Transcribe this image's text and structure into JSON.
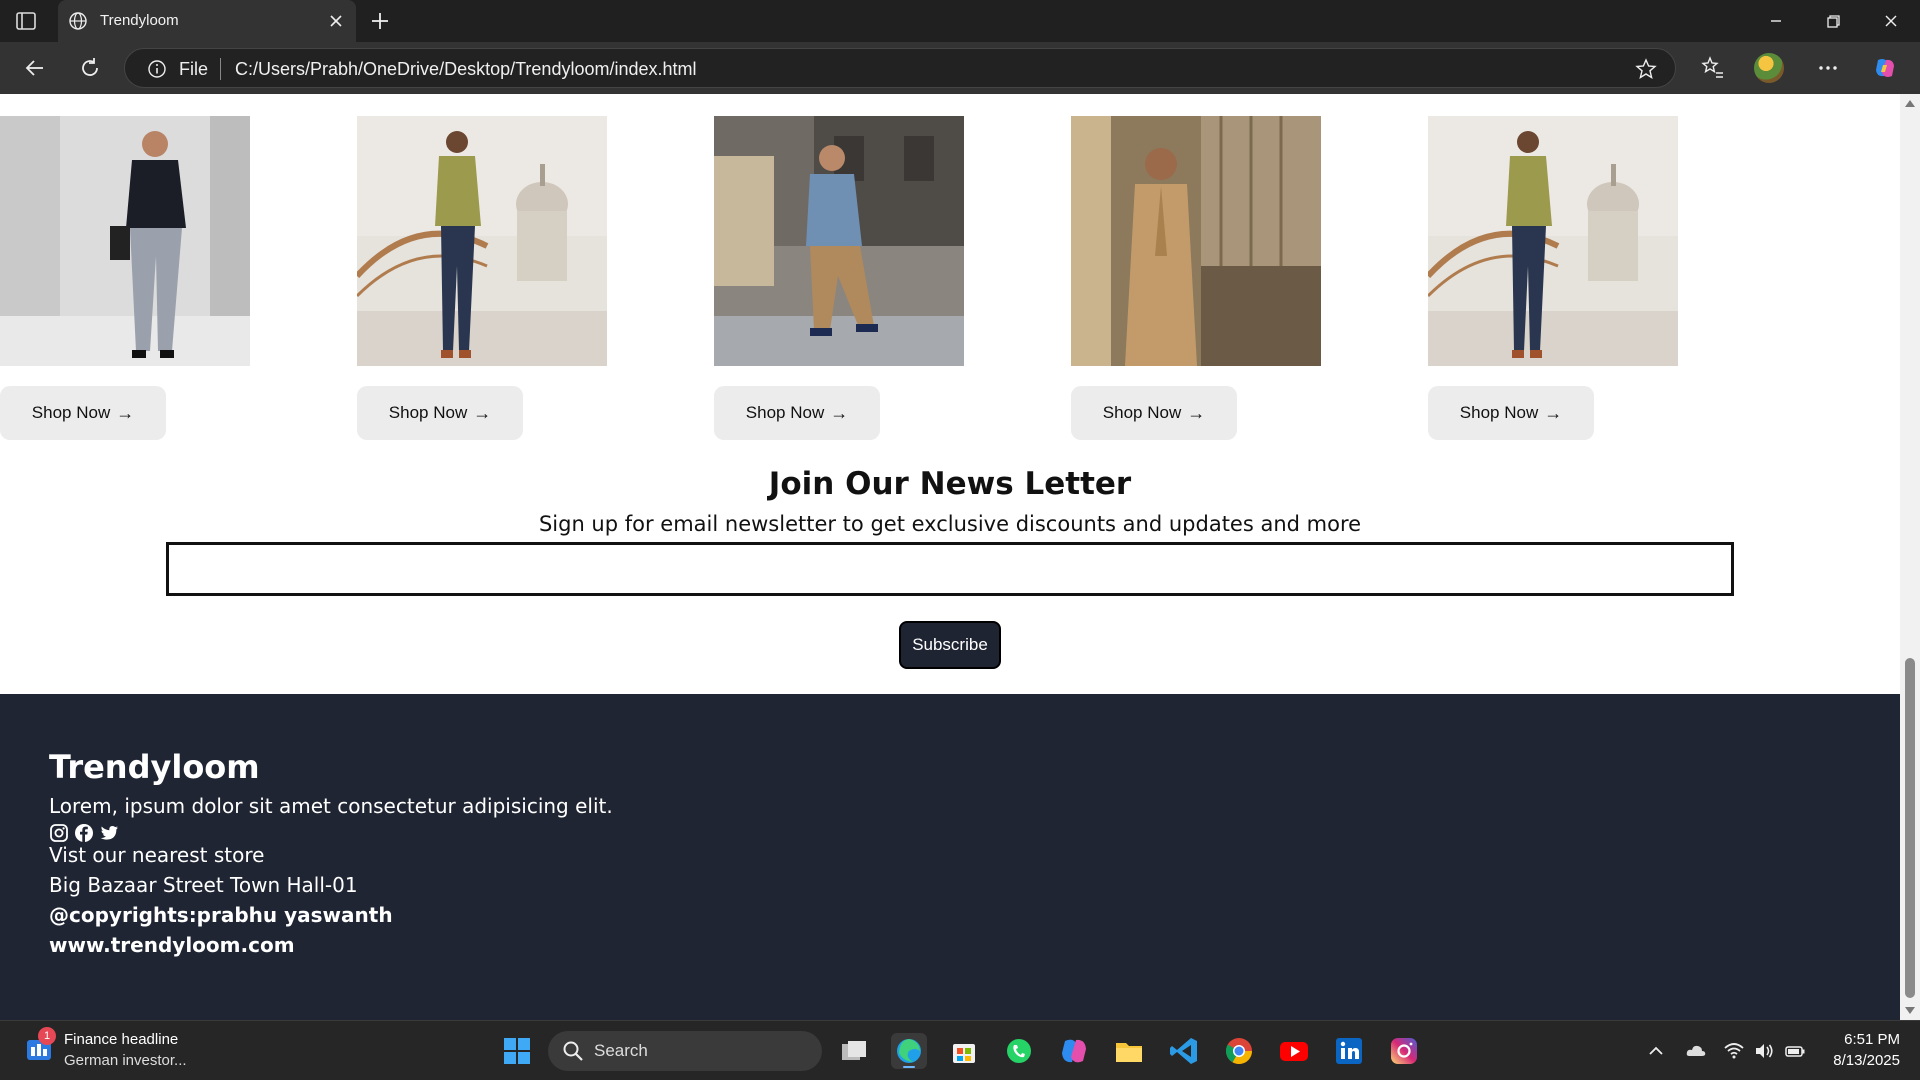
{
  "browser": {
    "tab_title": "Trendyloom",
    "address_scheme": "File",
    "address_url": "C:/Users/Prabh/OneDrive/Desktop/Trendyloom/index.html"
  },
  "products": [
    {
      "photo": "man-dark-shirt-photo",
      "shop_label": "Shop Now"
    },
    {
      "photo": "man-olive-blazer-photo",
      "shop_label": "Shop Now"
    },
    {
      "photo": "man-denim-jacket-photo",
      "shop_label": "Shop Now"
    },
    {
      "photo": "man-ethnic-wear-photo",
      "shop_label": "Shop Now"
    },
    {
      "photo": "man-olive-blazer-photo",
      "shop_label": "Shop Now"
    }
  ],
  "newsletter": {
    "title": "Join Our News Letter",
    "subtitle": "Sign up for email newsletter to get exclusive discounts and updates and more",
    "input_value": "",
    "subscribe_label": "Subscribe"
  },
  "footer": {
    "brand": "Trendyloom",
    "tagline": "Lorem, ipsum dolor sit amet consectetur adipisicing elit.",
    "social_icons": [
      "instagram-icon",
      "facebook-icon",
      "twitter-icon"
    ],
    "store_heading": "Vist our nearest store",
    "address": "Big Bazaar Street Town Hall-01",
    "copyright": "@copyrights:prabhu yaswanth",
    "website": "www.trendyloom.com"
  },
  "taskbar": {
    "widget_badge": "1",
    "widget_title": "Finance headline",
    "widget_subtitle": "German investor...",
    "search_label": "Search",
    "time": "6:51 PM",
    "date": "8/13/2025"
  },
  "colors": {
    "footer_bg": "#1f2533",
    "subscribe_bg": "#1f2433",
    "shop_button_bg": "#ececec"
  }
}
